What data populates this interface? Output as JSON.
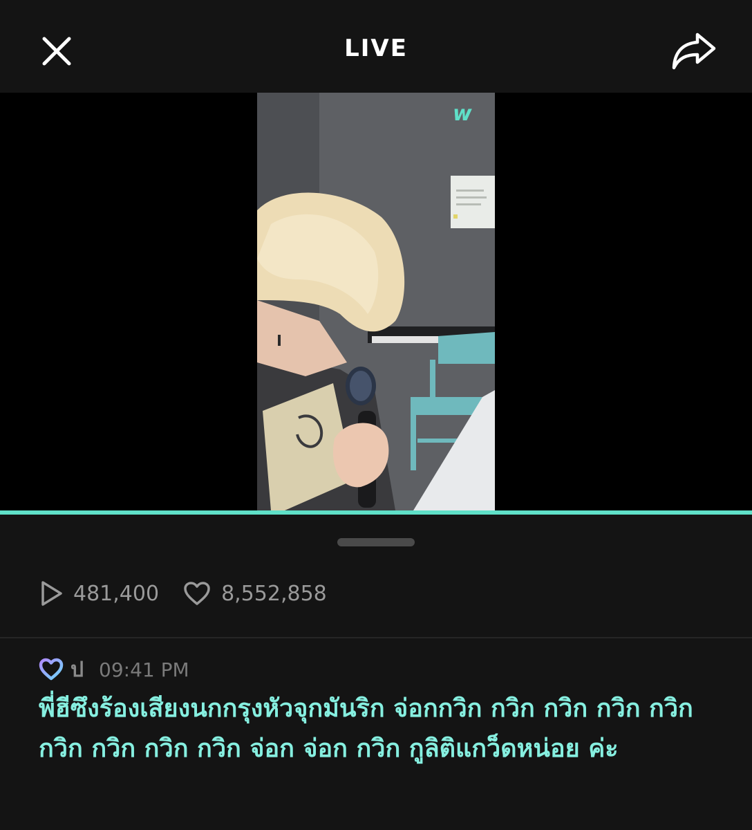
{
  "header": {
    "title": "LIVE",
    "close_icon": "close-icon",
    "share_icon": "share-icon"
  },
  "video": {
    "watermark": "w",
    "progress_fraction": 1.0
  },
  "stats": {
    "plays": "481,400",
    "likes": "8,552,858"
  },
  "comment": {
    "badge_icon": "heart-badge-icon",
    "author": "ป",
    "time": "09:41 PM",
    "text": "พี่ฮีซึงร้องเสียงนกกรุงหัวจุกมันริก จ่อกกวิก กวิก กวิก กวิก กวิก กวิก กวิก กวิก กวิก จ่อก จ่อก กวิก กูลิติแกว็ดหน่อย ค่ะ"
  },
  "colors": {
    "background": "#141414",
    "accent": "#5fe0c8",
    "comment_text": "#86efe0",
    "muted": "#9a9a9a"
  }
}
